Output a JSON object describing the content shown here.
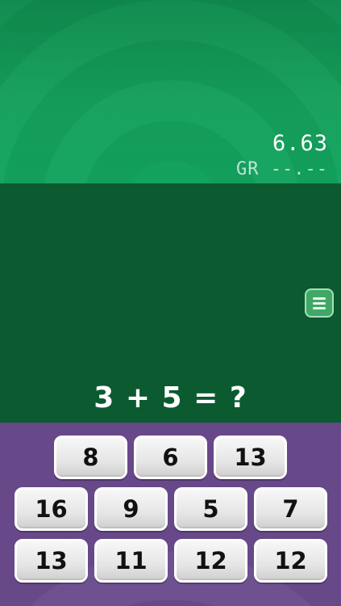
{
  "header": {
    "timer": "6.63",
    "best_time": "GR --.--"
  },
  "board": {
    "question": "3 + 5 = ?",
    "menu_icon": "hamburger-menu-icon"
  },
  "answers": {
    "row1": [
      "8",
      "6",
      "13"
    ],
    "row2": [
      "16",
      "9",
      "5",
      "7"
    ],
    "row3": [
      "13",
      "11",
      "12",
      "12"
    ]
  },
  "colors": {
    "top_green": "#13a35f",
    "board_green": "#0b5a30",
    "purple": "#6a4a8c"
  }
}
